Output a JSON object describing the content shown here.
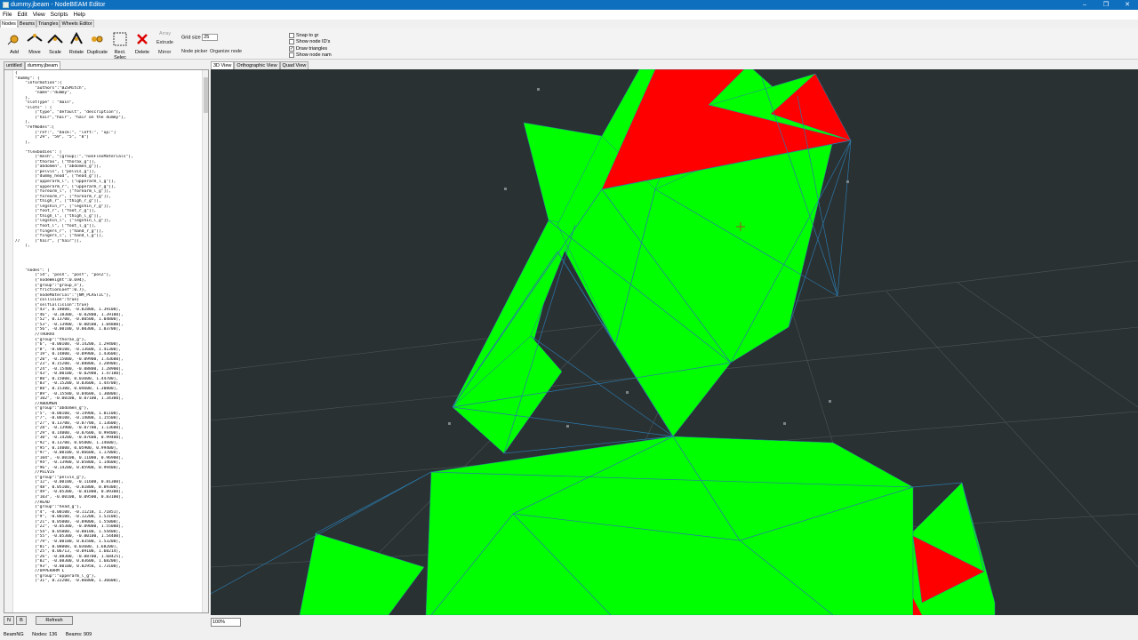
{
  "window": {
    "title": "dummy.jbeam - NodeBEAM Editor",
    "buttons": [
      "–",
      "❐",
      "✕"
    ]
  },
  "menu": [
    "File",
    "Edit",
    "View",
    "Scripts",
    "Help"
  ],
  "mode_tabs": {
    "nodes": "Nodes",
    "beams": "Beams",
    "triangles": "Triangles",
    "wheels": "Wheels Editor"
  },
  "toolbar": {
    "add": "Add",
    "move": "Move",
    "scale": "Scale",
    "rotate": "Rotate",
    "duplicate": "Duplicate",
    "rect_select": "Rect. Selec",
    "delete": "Delete",
    "array": "Array",
    "extrude": "Extrude",
    "mirror": "Mirror",
    "node_picker": "Node picker",
    "organize": "Organize node",
    "grid_label": "Grid size",
    "grid_value": "25"
  },
  "checks": [
    {
      "label": "Snap to gr",
      "checked": false
    },
    {
      "label": "Show node ID's",
      "checked": false
    },
    {
      "label": "Draw triangles",
      "checked": true
    },
    {
      "label": "Show node nam",
      "checked": false
    }
  ],
  "file_tabs": {
    "untitled": "untitled",
    "current": "dummy.jbeam"
  },
  "view_tabs": {
    "v3d": "3D View",
    "ortho": "Orthographic View",
    "quad": "Quad View"
  },
  "code_lines": [
    "{",
    "\"dummy\": {",
    "    \"information\":{",
    "        \"authors\":\"BZSMitch\",",
    "        \"name\":\"dummy\",",
    "    },",
    "    \"slotType\" : \"main\",",
    "    \"slots\" : [",
    "        [\"type\", \"default\", \"description\"],",
    "        [\"hair\",\"hair\", \"hair on the dummy\"],",
    "    ],",
    "    \"refNodes\":[",
    "        [\"ref:\", \"back:\", \"left:\", \"up:\"]",
    "        [\"29\", \"59\", \"5\", \"8\"]",
    "    ],",
    "",
    "    \"flexbodies\": [",
    "        [\"mesh\", \"[group]:\",\"nonFlexMaterials\"],",
    "        [\"thorax\", [\"thorax_g\"]],",
    "        [\"abdomen\", [\"abdomen_g\"]],",
    "        [\"pelvis\", [\"pelvis_g\"]],",
    "        [\"dummy_head\", [\"head_g\"]],",
    "        [\"upperarm_l\", [\"upperarm_l_g\"]],",
    "        [\"upperarm_r\", [\"upperarm_r_g\"]],",
    "        [\"forearm_l\", [\"forearm_l_g\"]],",
    "        [\"forearm_r\", [\"forearm_r_g\"]],",
    "        [\"thigh_r\", [\"thigh_r_g\"]],",
    "        [\"legshin_r\", [\"legshin_r_g\"]],",
    "        [\"foot_r\", [\"foot_r_g\"]],",
    "        [\"thigh_l\", [\"thigh_l_g\"]],",
    "        [\"legshin_l\", [\"legshin_l_g\"]],",
    "        [\"foot_l\", [\"foot_l_g\"]],",
    "        [\"fingers_r\", [\"hand_r_g\"]],",
    "        [\"fingers_l\", [\"hand_l_g\"]],",
    "//      [\"hair\", [\"hair\"]],",
    "    ],",
    "",
    "",
    "",
    "",
    "    \"nodes\": [",
    "        [\"id\", \"posX\", \"posY\", \"posZ\"],",
    "        {\"nodeWeight\":0.694},",
    "        {\"group\":\"group_n\"},",
    "        {\"frictionCoef\":0.7},",
    "        {\"nodeMaterial\":\"|NM_PLASTIC\"},",
    "        {\"collision\":true}",
    "        {\"selfCollision\":true}",
    "        [\"43\", 0.18000, -0.02800, 1.39100],",
    "        [\"46\", -0.18300, -0.02800, 1.39100],",
    "        [\"52\", 0.13700, -0.00500, 1.04800],",
    "        [\"53\", -0.13900, -0.00500, 1.04800],",
    "        [\"56\", -0.00100, 0.00300, 1.03700],",
    "        //THORAX",
    "        {\"group\":\"thorax_g\"},",
    "        [\"6\", -0.00100, -0.14200, 1.29400],",
    "        [\"8\", -0.00100, -0.13600, 1.41300],",
    "        [\"19\", 0.14800, -0.09900, 1.43600],",
    "        [\"20\", -0.15000, -0.09900, 1.43600],",
    "        [\"23\", 0.15200, -0.08800, 1.28900],",
    "        [\"24\", -0.15400, -0.08800, 1.28900],",
    "        [\"43\", -0.00100, -0.02900, 1.47100],",
    "        [\"80\", 0.15000, 0.03600, 1.44700],",
    "        [\"83\", -0.15200, 0.03600, 1.44700],",
    "        [\"88\", 0.15300, 0.04600, 1.30800],",
    "        [\"89\", -0.15500, 0.04600, 1.30800],",
    "        [\"102\", -0.00100, 0.07100, 1.34300],",
    "        //ABDOMEN",
    "        {\"group\":\"abdomen_g\"},",
    "        [\"5\", -0.00100, -0.14900, 1.01100],",
    "        [\"7\", -0.00100, -0.14000, 1.15500],",
    "        [\"27\", 0.13700, -0.07700, 1.13600],",
    "        [\"28\", -0.13900, -0.07700, 1.13600],",
    "        [\"29\", 0.14000, -0.07600, 0.99400],",
    "        [\"30\", -0.14200, -0.07600, 0.99400],",
    "        [\"92\", 0.13700, 0.05800, 1.14600],",
    "        [\"95\", 0.14000, 0.05900, 0.99400],",
    "        [\"97\", -0.00100, 0.06600, 1.17000],",
    "        [\"104\", -0.00100, 0.11000, 0.96900],",
    "        [\"94\", -0.13900, 0.05800, 1.14600],",
    "        [\"96\", -0.14200, 0.05900, 0.99400],",
    "        //PELVIS",
    "        {\"group\":\"pelvis_g\"},",
    "        [\"12\", -0.00100, -0.11600, 0.81300],",
    "        [\"48\", 0.05100, -0.01800, 0.89300],",
    "        [\"49\", -0.05300, -0.01800, 0.89300],",
    "        [\"103\", -0.00100, 0.09500, 0.83100],",
    "        //HEAD",
    "        {\"group\":\"head_g\"},",
    "        [\"4\", -0.00100, -0.11218, 1.71851],",
    "        [\"9\", -0.00100, -0.12200, 1.53100],",
    "        [\"21\", 0.05000, -0.09000, 1.55000],",
    "        [\"22\", -0.05300, -0.09000, 1.55000],",
    "        [\"54\", 0.05000, -0.00100, 1.54400],",
    "        [\"55\", -0.05300, -0.00100, 1.54400],",
    "        [\"79\", -0.00100, 0.03500, 1.53200],",
    "        [\"81\", 0.08000, 0.03600, 1.68200],",
    "        [\"25\", 0.06713, -0.09100, 1.68214],",
    "        [\"26\", -0.08300, -0.08700, 1.68425],",
    "        [\"82\", -0.08300, 0.03600, 1.68200],",
    "        [\"93\", -0.00100, 0.02958, 1.73100],",
    "        //UPPERARM L",
    "        {\"group\":\"upperarm_l_g\"},",
    "        [\"31\", 0.22200, -0.06800, 1.36600],"
  ],
  "bottom": {
    "n_label": "N",
    "b_label": "B",
    "refresh": "Refresh",
    "zoom": "100%"
  },
  "status": {
    "engine": "BeamNG",
    "nodes": "Nodes: 136",
    "beams": "Beams: 909"
  },
  "colors": {
    "mesh_green": "#00ff00",
    "mesh_red": "#ff0000",
    "beam_blue": "#2a78a8",
    "viewport_bg": "#2a3133",
    "title_blue": "#0f6fbf"
  }
}
